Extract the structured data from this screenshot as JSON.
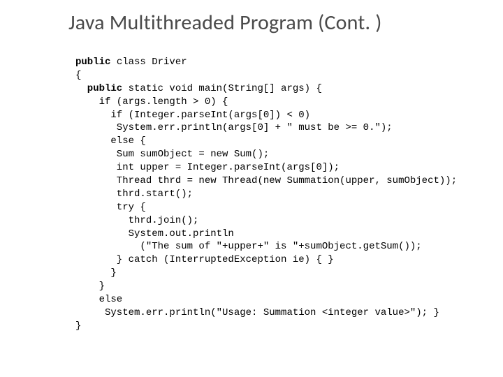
{
  "title": "Java Multithreaded Program (Cont. )",
  "code": {
    "l01a": "public",
    "l01b": " class Driver",
    "l02": "{",
    "l03a": "  public",
    "l03b": " static void main(String[] args) {",
    "l04": "    if (args.length > 0) {",
    "l05": "      if (Integer.parseInt(args[0]) < 0)",
    "l06": "       System.err.println(args[0] + \" must be >= 0.\");",
    "l07": "      else {",
    "l08": "       Sum sumObject = new Sum();",
    "l09": "       int upper = Integer.parseInt(args[0]);",
    "l10": "       Thread thrd = new Thread(new Summation(upper, sumObject));",
    "l11": "       thrd.start();",
    "l12": "       try {",
    "l13": "         thrd.join();",
    "l14": "         System.out.println",
    "l15": "           (\"The sum of \"+upper+\" is \"+sumObject.getSum());",
    "l16": "       } catch (InterruptedException ie) { }",
    "l17": "      }",
    "l18": "    }",
    "l19": "    else",
    "l20": "     System.err.println(\"Usage: Summation <integer value>\"); }",
    "l21": "}"
  }
}
